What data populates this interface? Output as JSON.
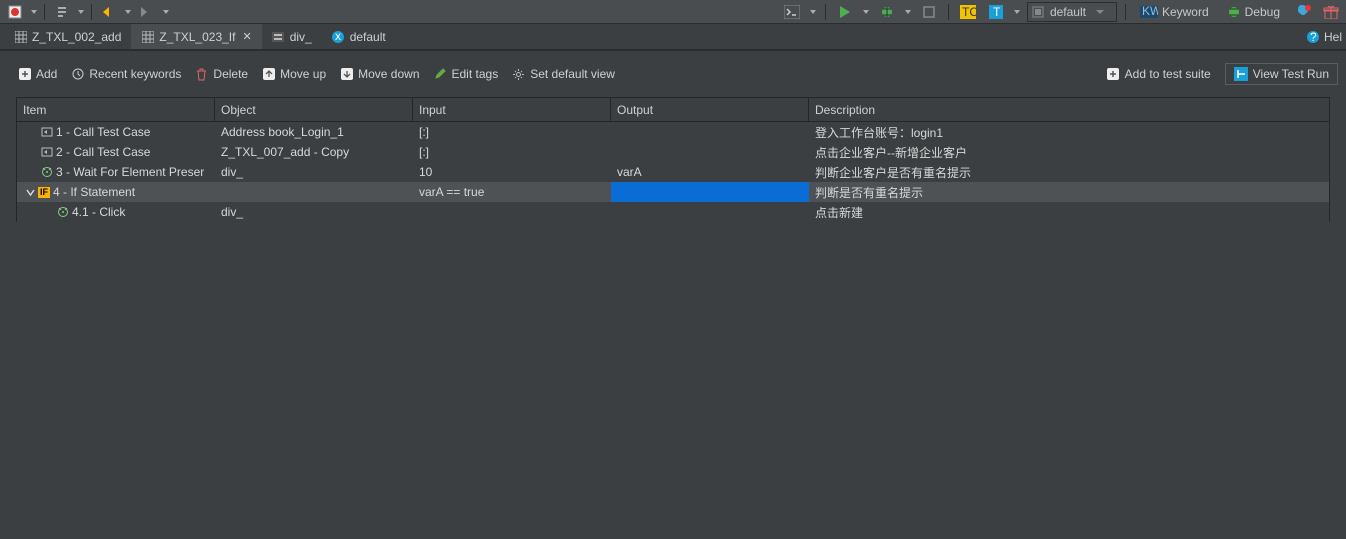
{
  "top_toolbar": {
    "profile_combo": "default",
    "keyword_label": "Keyword",
    "debug_label": "Debug"
  },
  "tabs": [
    {
      "label": "Z_TXL_002_add",
      "type": "grid",
      "active": false
    },
    {
      "label": "Z_TXL_023_If",
      "type": "grid",
      "active": true
    },
    {
      "label": "div_",
      "type": "object",
      "active": false
    },
    {
      "label": "default",
      "type": "variable",
      "active": false
    }
  ],
  "help_label": "Hel",
  "actions": {
    "add": "Add",
    "recent": "Recent keywords",
    "delete": "Delete",
    "moveup": "Move up",
    "movedown": "Move down",
    "edittags": "Edit tags",
    "defaultview": "Set default view",
    "addtosuite": "Add to test suite",
    "viewtestrun": "View Test Run"
  },
  "columns": {
    "item": "Item",
    "object": "Object",
    "input": "Input",
    "output": "Output",
    "description": "Description"
  },
  "rows": [
    {
      "depth": 1,
      "icon": "call",
      "item": "1 - Call Test Case",
      "object": "Address book_Login_1",
      "input": "[:]",
      "output": "",
      "desc": "登入工作台账号：login1",
      "selected": false
    },
    {
      "depth": 1,
      "icon": "call",
      "item": "2 - Call Test Case",
      "object": "Z_TXL_007_add - Copy",
      "input": "[:]",
      "output": "",
      "desc": "点击企业客户--新增企业客户",
      "selected": false
    },
    {
      "depth": 1,
      "icon": "wait",
      "item": "3 - Wait For Element Preser",
      "object": "div_",
      "input": "10",
      "output": "varA",
      "desc": "判断企业客户是否有重名提示",
      "selected": false
    },
    {
      "depth": 0,
      "icon": "if",
      "item": "4 - If Statement",
      "object": "",
      "input": "varA == true",
      "output": "",
      "desc": "判断是否有重名提示",
      "selected": true,
      "expandable": true
    },
    {
      "depth": 2,
      "icon": "click",
      "item": "4.1 - Click",
      "object": "div_",
      "input": "",
      "output": "",
      "desc": "点击新建",
      "selected": false
    }
  ]
}
